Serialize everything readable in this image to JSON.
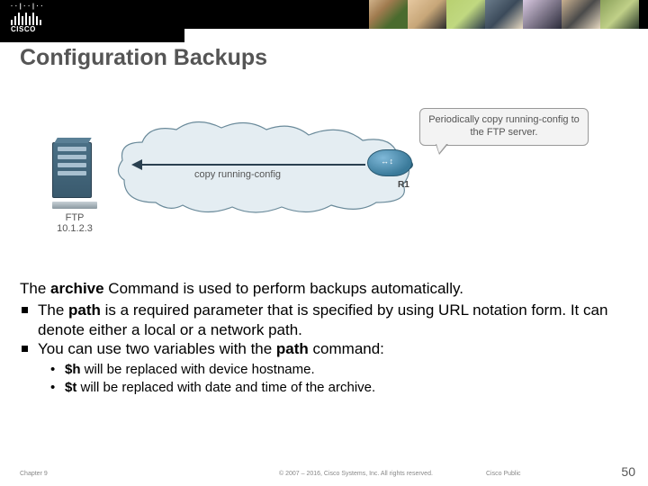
{
  "banner": {
    "brand": "CISCO"
  },
  "title": "Configuration Backups",
  "diagram": {
    "server": {
      "label": "FTP",
      "ip": "10.1.2.3"
    },
    "arrow_label": "copy running-config",
    "router": {
      "label": "R1"
    },
    "callout": "Periodically copy running-config to the FTP server."
  },
  "body": {
    "intro_pre": "The ",
    "intro_cmd": "archive",
    "intro_post": " Command is used to perform backups automatically.",
    "b1_pre": "The ",
    "b1_bold": "path",
    "b1_post": " is a required parameter that is specified by using URL notation form. It can denote either a local or a network path.",
    "b2_pre": "You can use two variables with the ",
    "b2_bold": "path",
    "b2_post": " command:",
    "s1_bold": "$h",
    "s1_post": " will be replaced with device hostname.",
    "s2_bold": "$t",
    "s2_post": " will be replaced with date and time of the archive."
  },
  "footer": {
    "chapter": "Chapter 9",
    "copyright": "© 2007 – 2016, Cisco Systems, Inc. All rights reserved.",
    "public": "Cisco Public",
    "page": "50"
  }
}
